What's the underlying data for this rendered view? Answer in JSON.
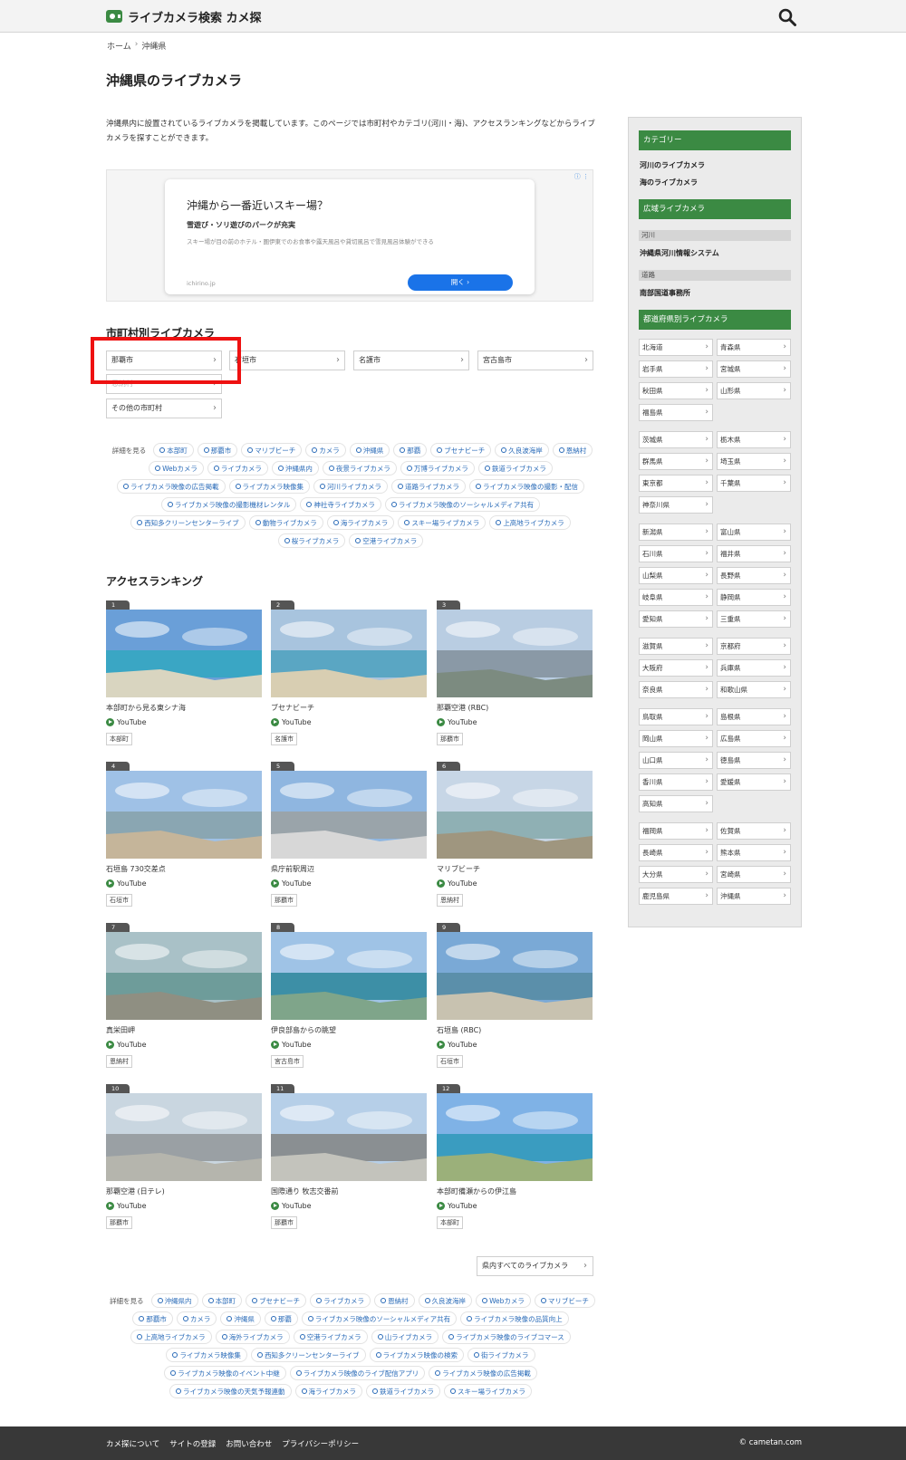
{
  "header": {
    "logo_text": "ライブカメラ検索 カメ探"
  },
  "breadcrumb": {
    "home": "ホーム",
    "sep": "›",
    "current": "沖縄県"
  },
  "page_title": "沖縄県のライブカメラ",
  "intro": "沖縄県内に設置されているライブカメラを掲載しています。このページでは市町村やカテゴリ(河川・海)、アクセスランキングなどからライブカメラを探すことができます。",
  "ad": {
    "title": "沖縄から一番近いスキー場？",
    "subtitle": "雪遊び・ソリ遊びのパークが充実",
    "description": "スキー場が目の前のホテル・圏伊東でのお食事や露天風呂や貸切風呂で雪見風呂体験ができる",
    "source": "ichirino.jp",
    "open_label": "開く ›"
  },
  "city_section": {
    "title": "市町村別ライブカメラ",
    "cities": [
      "那覇市",
      "石垣市",
      "名護市",
      "宮古島市",
      "恩納村",
      "その他の市町村"
    ]
  },
  "tags_top": {
    "lead": "詳細を見る",
    "items": [
      "本部町",
      "那覇市",
      "マリブビーチ",
      "カメラ",
      "沖縄県",
      "那覇",
      "ブセナビーチ",
      "久良波海岸",
      "恩納村",
      "Webカメラ",
      "ライブカメラ",
      "沖縄県内",
      "夜景ライブカメラ",
      "万博ライブカメラ",
      "鉄道ライブカメラ",
      "ライブカメラ映像の広告掲載",
      "ライブカメラ映像集",
      "河川ライブカメラ",
      "道路ライブカメラ",
      "ライブカメラ映像の撮影・配信",
      "ライブカメラ映像の撮影機材レンタル",
      "神社寺ライブカメラ",
      "ライブカメラ映像のソーシャルメディア共有",
      "西知多クリーンセンターライブ",
      "動物ライブカメラ",
      "海ライブカメラ",
      "スキー場ライブカメラ",
      "上高地ライブカメラ",
      "桜ライブカメラ",
      "空港ライブカメラ"
    ]
  },
  "ranking": {
    "title": "アクセスランキング",
    "items": [
      {
        "rank": "1",
        "title": "本部町から見る東シナ海",
        "source": "YouTube",
        "location": "本部町"
      },
      {
        "rank": "2",
        "title": "ブセナビーチ",
        "source": "YouTube",
        "location": "名護市"
      },
      {
        "rank": "3",
        "title": "那覇空港 (RBC)",
        "source": "YouTube",
        "location": "那覇市"
      },
      {
        "rank": "4",
        "title": "石垣島 730交差点",
        "source": "YouTube",
        "location": "石垣市"
      },
      {
        "rank": "5",
        "title": "県庁前駅周辺",
        "source": "YouTube",
        "location": "那覇市"
      },
      {
        "rank": "6",
        "title": "マリブビーチ",
        "source": "YouTube",
        "location": "恩納村"
      },
      {
        "rank": "7",
        "title": "真栄田岬",
        "source": "YouTube",
        "location": "恩納村"
      },
      {
        "rank": "8",
        "title": "伊良部島からの眺望",
        "source": "YouTube",
        "location": "宮古島市"
      },
      {
        "rank": "9",
        "title": "石垣島 (RBC)",
        "source": "YouTube",
        "location": "石垣市"
      },
      {
        "rank": "10",
        "title": "那覇空港 (日テレ)",
        "source": "YouTube",
        "location": "那覇市"
      },
      {
        "rank": "11",
        "title": "国際通り 牧志交番前",
        "source": "YouTube",
        "location": "那覇市"
      },
      {
        "rank": "12",
        "title": "本部町備瀬からの伊江島",
        "source": "YouTube",
        "location": "本部町"
      }
    ],
    "all_button": "県内すべてのライブカメラ"
  },
  "tags_bottom": {
    "lead": "詳細を見る",
    "items": [
      "沖縄県内",
      "本部町",
      "ブセナビーチ",
      "ライブカメラ",
      "恩納村",
      "久良波海岸",
      "Webカメラ",
      "マリブビーチ",
      "那覇市",
      "カメラ",
      "沖縄県",
      "那覇",
      "ライブカメラ映像のソーシャルメディア共有",
      "ライブカメラ映像の品質向上",
      "上高地ライブカメラ",
      "海外ライブカメラ",
      "空港ライブカメラ",
      "山ライブカメラ",
      "ライブカメラ映像のライブコマース",
      "ライブカメラ映像集",
      "西知多クリーンセンターライブ",
      "ライブカメラ映像の検索",
      "街ライブカメラ",
      "ライブカメラ映像のイベント中継",
      "ライブカメラ映像のライブ配信アプリ",
      "ライブカメラ映像の広告掲載",
      "ライブカメラ映像の天気予報連動",
      "海ライブカメラ",
      "鉄道ライブカメラ",
      "スキー場ライブカメラ"
    ]
  },
  "sidebar": {
    "category_head": "カテゴリー",
    "category_links": [
      "河川のライブカメラ",
      "海のライブカメラ"
    ],
    "wide_head": "広域ライブカメラ",
    "river_label": "河川",
    "river_link": "沖縄県河川情報システム",
    "road_label": "道路",
    "road_link": "南部国道事務所",
    "pref_head": "都道府県別ライブカメラ",
    "prefs": [
      [
        "北海道",
        "青森県",
        "岩手県",
        "宮城県",
        "秋田県",
        "山形県",
        "福島県"
      ],
      [
        "茨城県",
        "栃木県",
        "群馬県",
        "埼玉県",
        "東京都",
        "千葉県",
        "神奈川県"
      ],
      [
        "新潟県",
        "富山県",
        "石川県",
        "福井県",
        "山梨県",
        "長野県",
        "岐阜県",
        "静岡県",
        "愛知県",
        "三重県"
      ],
      [
        "滋賀県",
        "京都府",
        "大阪府",
        "兵庫県",
        "奈良県",
        "和歌山県"
      ],
      [
        "鳥取県",
        "島根県",
        "岡山県",
        "広島県",
        "山口県",
        "徳島県",
        "香川県",
        "愛媛県",
        "高知県"
      ],
      [
        "福岡県",
        "佐賀県",
        "長崎県",
        "熊本県",
        "大分県",
        "宮崎県",
        "鹿児島県",
        "沖縄県"
      ]
    ]
  },
  "footer": {
    "links": [
      "カメ探について",
      "サイトの登録",
      "お問い合わせ",
      "プライバシーポリシー"
    ],
    "copyright": "© cametan.com"
  },
  "colors": {
    "brand": "#3b8a43",
    "link": "#2a6bb8",
    "highlight": "#ee1111",
    "footer_bg": "#383838"
  },
  "icons": {
    "logo": "camera-icon",
    "search": "search-icon",
    "source": "play-icon"
  }
}
